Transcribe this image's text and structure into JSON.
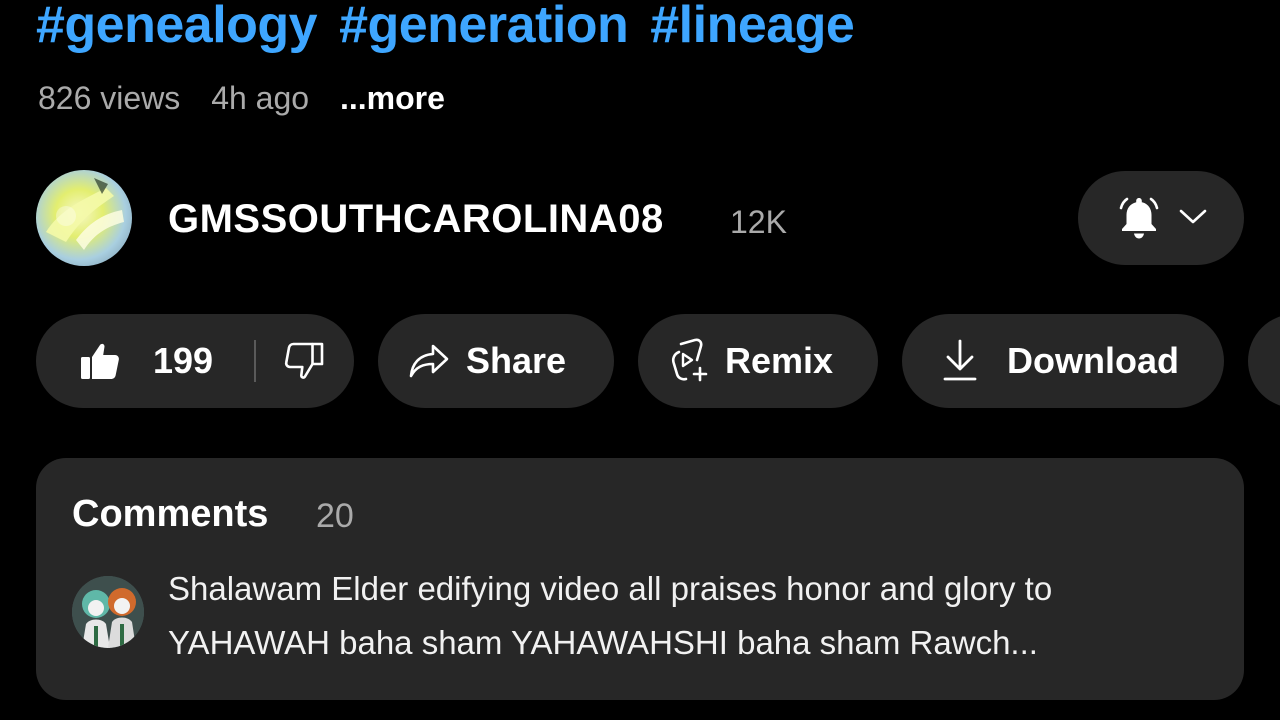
{
  "video": {
    "hashtags": [
      "#genealogy",
      "#generation",
      "#lineage"
    ],
    "views": "826 views",
    "age": "4h ago",
    "more_label": "...more"
  },
  "channel": {
    "name": "GMSSOUTHCAROLINA08",
    "subscribers": "12K",
    "bell_icon": "bell-filled-icon",
    "chevron_icon": "chevron-down-icon"
  },
  "actions": {
    "likes": "199",
    "share_label": "Share",
    "remix_label": "Remix",
    "download_label": "Download"
  },
  "comments": {
    "title": "Comments",
    "count": "20",
    "top_comment": "Shalawam Elder edifying video all praises honor and glory to YAHAWAH baha sham YAHAWAHSHI baha sham Rawch..."
  },
  "colors": {
    "background": "#000000",
    "pill": "#272727",
    "hashtag": "#3ea6ff",
    "secondary_text": "#aaaaaa"
  }
}
